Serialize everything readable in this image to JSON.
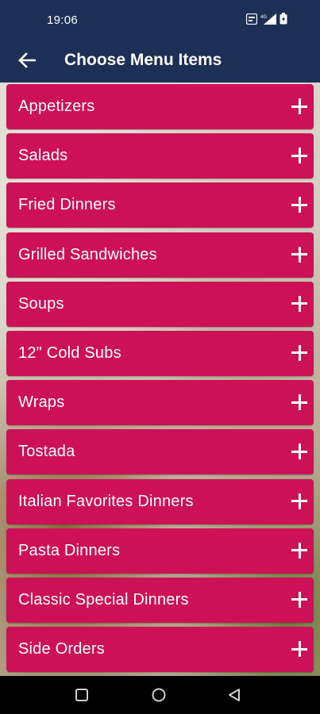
{
  "status": {
    "time": "19:06",
    "icons": [
      "data-saver-icon",
      "signal-icon",
      "battery-icon"
    ]
  },
  "appbar": {
    "back_icon": "arrow-left-icon",
    "title": "Choose Menu Items"
  },
  "menu": {
    "items": [
      {
        "label": "Appetizers"
      },
      {
        "label": "Salads"
      },
      {
        "label": "Fried Dinners"
      },
      {
        "label": "Grilled Sandwiches"
      },
      {
        "label": "Soups"
      },
      {
        "label": "12\" Cold Subs"
      },
      {
        "label": "Wraps"
      },
      {
        "label": "Tostada"
      },
      {
        "label": "Italian Favorites Dinners"
      },
      {
        "label": "Pasta Dinners"
      },
      {
        "label": "Classic Special Dinners"
      },
      {
        "label": "Side Orders"
      }
    ],
    "expand_icon": "plus-icon"
  },
  "navigation": {
    "buttons": [
      "recents-icon",
      "home-icon",
      "back-icon"
    ]
  },
  "colors": {
    "header": "#1c2f54",
    "item": "#cc1157",
    "nav": "#000000"
  }
}
